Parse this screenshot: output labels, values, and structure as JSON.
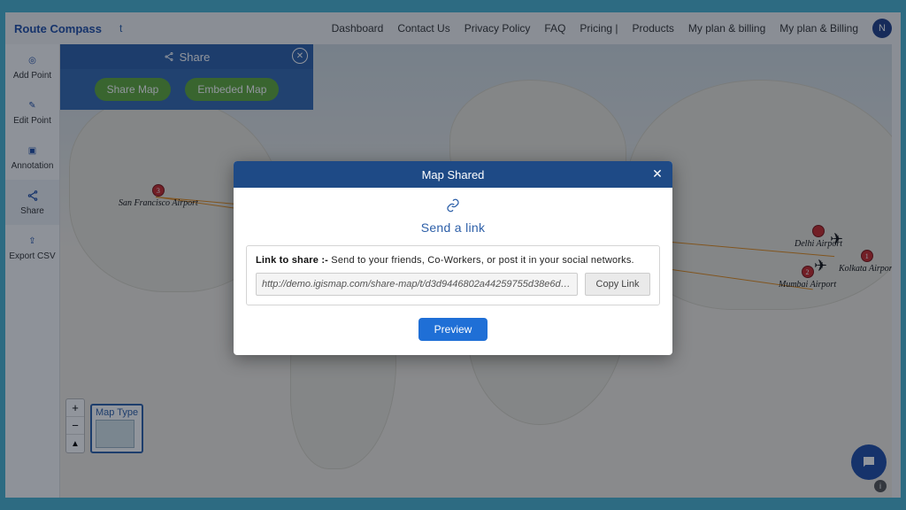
{
  "header": {
    "logo_primary": "Route Compass",
    "logo_secondary": "t",
    "nav": {
      "dashboard": "Dashboard",
      "contact": "Contact Us",
      "privacy": "Privacy Policy",
      "faq": "FAQ",
      "pricing": "Pricing |",
      "products": "Products",
      "plan1": "My plan & billing",
      "plan2": "My plan & Billing"
    },
    "avatar_initial": "N"
  },
  "sidebar": {
    "items": [
      {
        "label": "Add Point"
      },
      {
        "label": "Edit Point"
      },
      {
        "label": "Annotation"
      },
      {
        "label": "Share"
      },
      {
        "label": "Export CSV"
      }
    ]
  },
  "share_panel": {
    "title": "Share",
    "share_map": "Share Map",
    "embed_map": "Embeded Map"
  },
  "markers": [
    {
      "num": "3",
      "label": "San Francisco Airport"
    },
    {
      "num": "2",
      "label": "Mumbai Airport"
    },
    {
      "num": "1",
      "label": "Kolkata Airport"
    },
    {
      "num": "",
      "label": "Delhi Airport"
    }
  ],
  "map_type_label": "Map Type",
  "modal": {
    "title": "Map Shared",
    "send_link": "Send a link",
    "link_label_bold": "Link to share :-",
    "link_label_rest": " Send to your friends, Co-Workers, or post it in your social networks.",
    "url": "http://demo.igismap.com/share-map/t/d3d9446802a44259755d38e6d…",
    "copy": "Copy Link",
    "preview": "Preview"
  }
}
